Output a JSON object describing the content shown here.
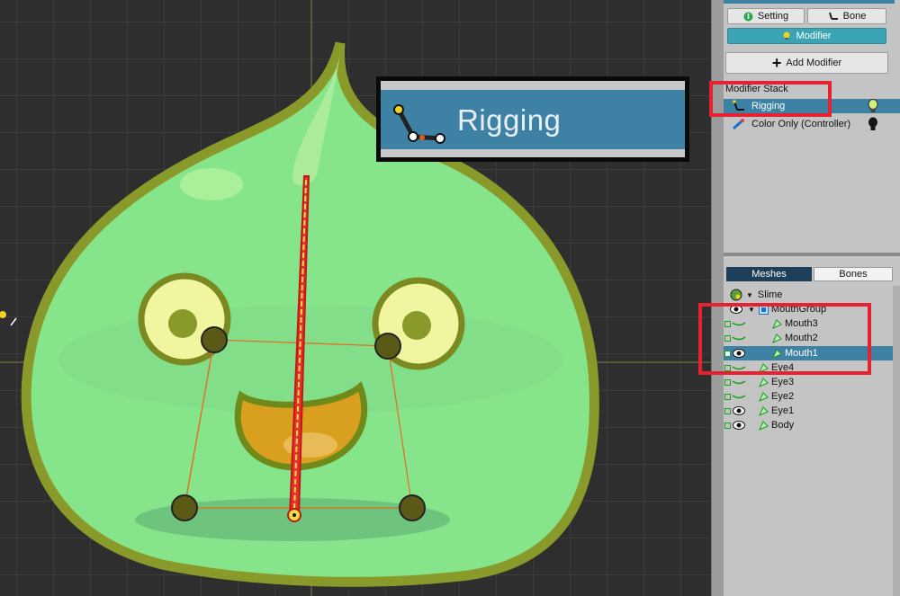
{
  "zoom_callout": {
    "label": "Rigging"
  },
  "panel": {
    "setting_label": "Setting",
    "bone_label": "Bone",
    "modifier_label": "Modifier",
    "add_modifier_label": "Add Modifier",
    "modifier_stack_title": "Modifier Stack",
    "modifiers": [
      {
        "label": "Rigging",
        "selected": true
      },
      {
        "label": "Color Only (Controller)",
        "selected": false
      }
    ],
    "tabs": {
      "meshes": "Meshes",
      "bones": "Bones"
    },
    "tree": [
      {
        "label": "Slime",
        "level": 0
      },
      {
        "label": "MouthGroup",
        "level": 1
      },
      {
        "label": "Mouth3",
        "level": 2
      },
      {
        "label": "Mouth2",
        "level": 2
      },
      {
        "label": "Mouth1",
        "level": 2,
        "selected": true
      },
      {
        "label": "Eye4",
        "level": 1
      },
      {
        "label": "Eye3",
        "level": 1
      },
      {
        "label": "Eye2",
        "level": 1
      },
      {
        "label": "Eye1",
        "level": 1
      },
      {
        "label": "Body",
        "level": 1
      }
    ]
  },
  "colors": {
    "selection": "#3d82a5",
    "highlight_box": "#e52232",
    "active_button": "#3aa4b4",
    "slime_body": "#86e58a",
    "slime_outline": "#8a9a2a"
  }
}
